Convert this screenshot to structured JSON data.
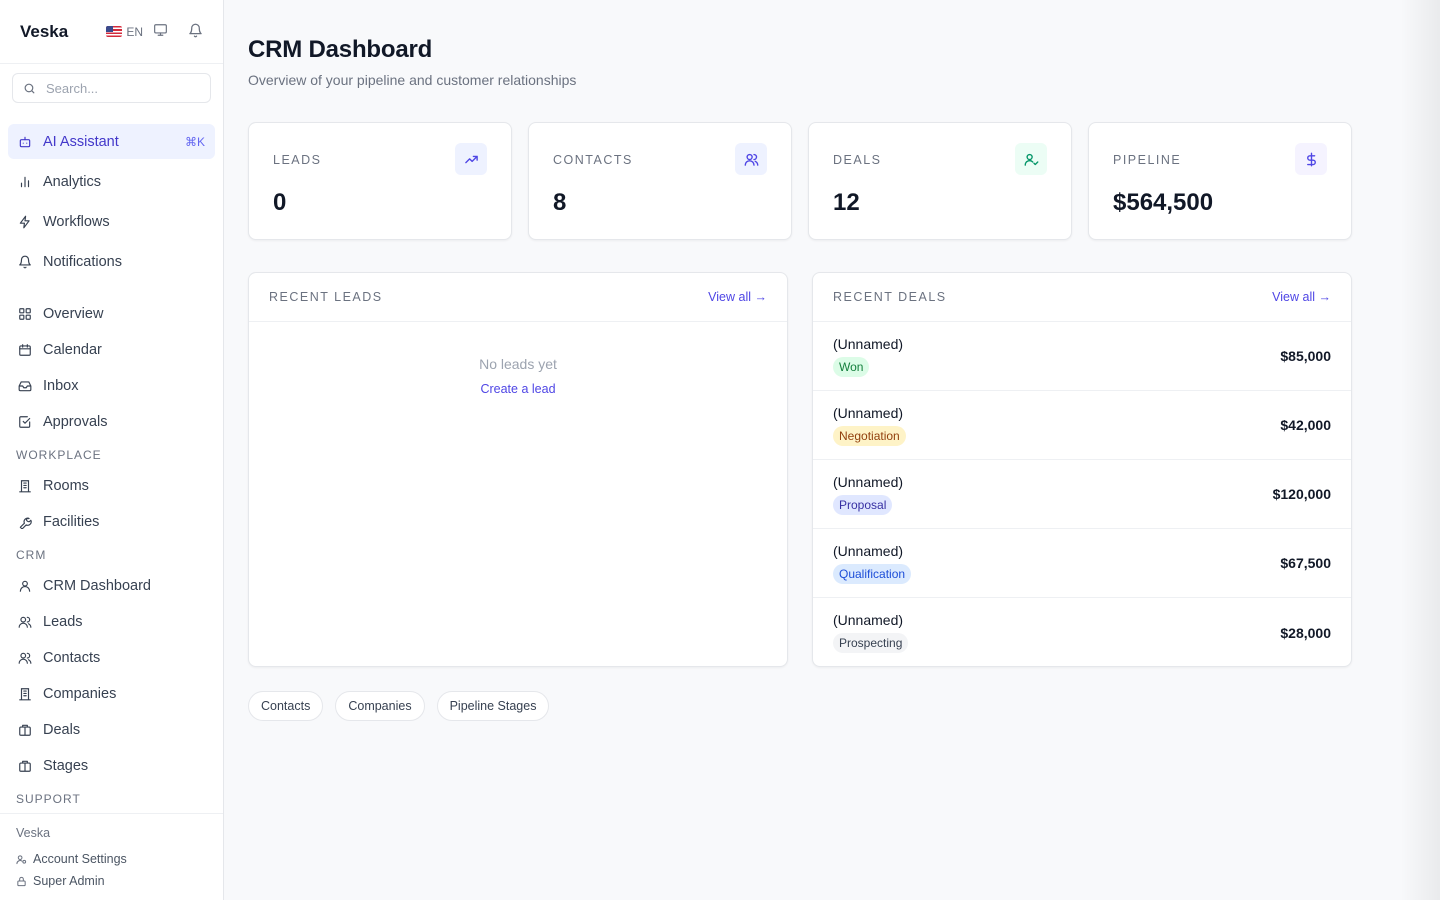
{
  "app": {
    "name": "Veska"
  },
  "header": {
    "language": "EN"
  },
  "search": {
    "placeholder": "Search..."
  },
  "sidebar": {
    "top_items": [
      {
        "label": "AI Assistant",
        "shortcut": "⌘K",
        "icon": "bot-icon"
      },
      {
        "label": "Analytics",
        "icon": "bar-chart-icon"
      },
      {
        "label": "Workflows",
        "icon": "zap-icon"
      },
      {
        "label": "Notifications",
        "icon": "bell-icon"
      }
    ],
    "main_items": [
      {
        "label": "Overview",
        "icon": "grid-icon"
      },
      {
        "label": "Calendar",
        "icon": "calendar-icon"
      },
      {
        "label": "Inbox",
        "icon": "inbox-icon"
      },
      {
        "label": "Approvals",
        "icon": "check-square-icon"
      }
    ],
    "workplace": {
      "label": "WORKPLACE",
      "items": [
        {
          "label": "Rooms",
          "icon": "building-icon"
        },
        {
          "label": "Facilities",
          "icon": "wrench-icon"
        }
      ]
    },
    "crm": {
      "label": "CRM",
      "items": [
        {
          "label": "CRM Dashboard",
          "icon": "user-icon"
        },
        {
          "label": "Leads",
          "icon": "users-icon"
        },
        {
          "label": "Contacts",
          "icon": "users-icon"
        },
        {
          "label": "Companies",
          "icon": "building-icon"
        },
        {
          "label": "Deals",
          "icon": "briefcase-icon"
        },
        {
          "label": "Stages",
          "icon": "briefcase-icon"
        }
      ]
    },
    "support_label": "SUPPORT"
  },
  "footer": {
    "org": "Veska",
    "account_settings": "Account Settings",
    "role": "Super Admin"
  },
  "page": {
    "title": "CRM Dashboard",
    "subtitle": "Overview of your pipeline and customer relationships"
  },
  "stats": [
    {
      "label": "LEADS",
      "value": "0",
      "icon": "trending-up-icon",
      "icon_bg": "#eef2ff",
      "icon_color": "#4f46e5"
    },
    {
      "label": "CONTACTS",
      "value": "8",
      "icon": "users-icon",
      "icon_bg": "#eef2ff",
      "icon_color": "#4f46e5"
    },
    {
      "label": "DEALS",
      "value": "12",
      "icon": "user-check-icon",
      "icon_bg": "#ecfdf5",
      "icon_color": "#059669"
    },
    {
      "label": "PIPELINE",
      "value": "$564,500",
      "icon": "dollar-icon",
      "icon_bg": "#f5f3ff",
      "icon_color": "#4f46e5"
    }
  ],
  "recent_leads": {
    "title": "RECENT LEADS",
    "view_all": "View all →",
    "empty_text": "No leads yet",
    "create_link": "Create a lead"
  },
  "recent_deals": {
    "title": "RECENT DEALS",
    "view_all": "View all →",
    "rows": [
      {
        "name": "(Unnamed)",
        "stage": "Won",
        "amount": "$85,000",
        "badge_bg": "#dcfce7",
        "badge_color": "#15803d"
      },
      {
        "name": "(Unnamed)",
        "stage": "Negotiation",
        "amount": "$42,000",
        "badge_bg": "#fef3c7",
        "badge_color": "#92400e"
      },
      {
        "name": "(Unnamed)",
        "stage": "Proposal",
        "amount": "$120,000",
        "badge_bg": "#e0e7ff",
        "badge_color": "#3730a3"
      },
      {
        "name": "(Unnamed)",
        "stage": "Qualification",
        "amount": "$67,500",
        "badge_bg": "#dbeafe",
        "badge_color": "#1d4ed8"
      },
      {
        "name": "(Unnamed)",
        "stage": "Prospecting",
        "amount": "$28,000",
        "badge_bg": "#f3f4f6",
        "badge_color": "#374151"
      }
    ]
  },
  "quick_links": [
    "Contacts",
    "Companies",
    "Pipeline Stages"
  ]
}
